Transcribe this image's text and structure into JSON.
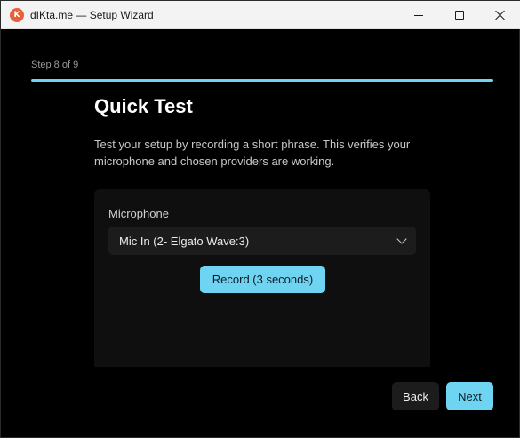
{
  "window": {
    "title": "dIKta.me — Setup Wizard",
    "app_icon_glyph": "K"
  },
  "wizard": {
    "step_label": "Step 8 of 9",
    "progress_fraction": 1.0,
    "heading": "Quick Test",
    "description": "Test your setup by recording a short phrase. This verifies your microphone and chosen providers are working."
  },
  "microphone": {
    "label": "Microphone",
    "selected": "Mic In (2- Elgato Wave:3)"
  },
  "record_button": {
    "label": "Record (3 seconds)"
  },
  "footer": {
    "back_label": "Back",
    "next_label": "Next"
  },
  "colors": {
    "accent": "#6fd4f2",
    "background": "#000000",
    "card": "#0f0f0f"
  }
}
